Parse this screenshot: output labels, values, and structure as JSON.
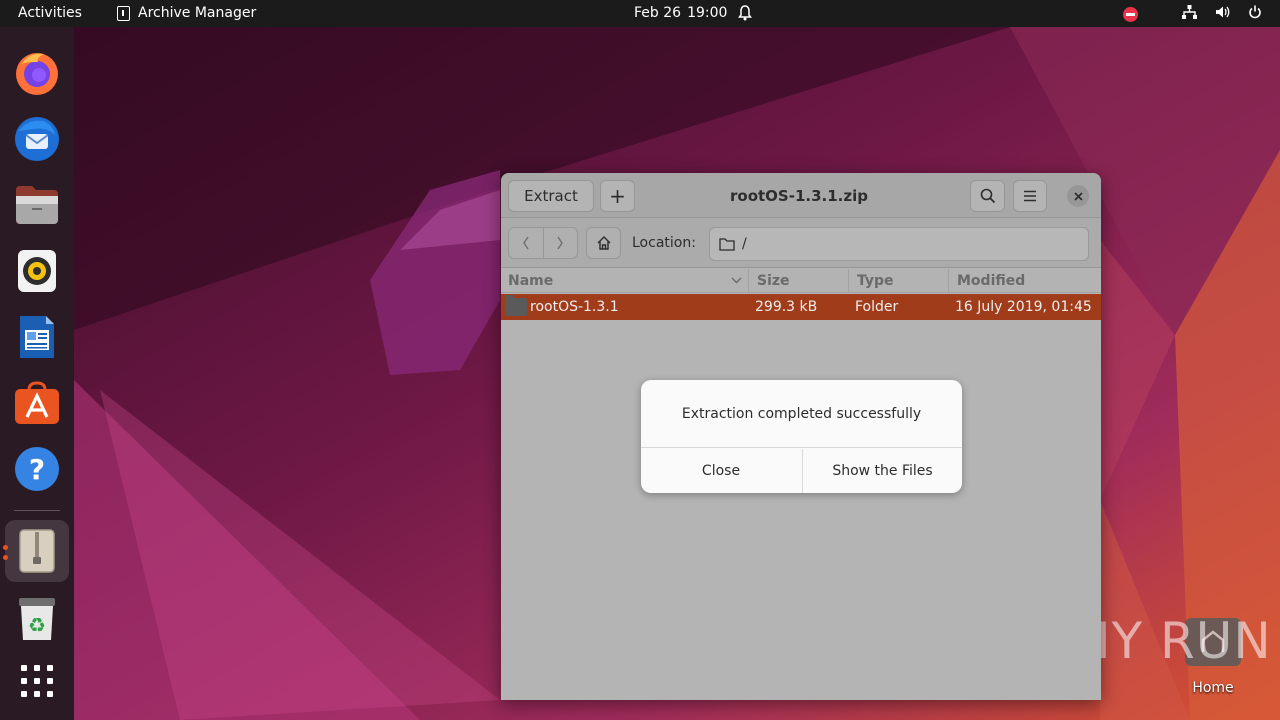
{
  "topbar": {
    "activities": "Activities",
    "app_name": "Archive Manager",
    "date": "Feb 26",
    "time": "19:00"
  },
  "dock": {
    "items": [
      {
        "name": "firefox-icon"
      },
      {
        "name": "thunderbird-icon"
      },
      {
        "name": "files-icon"
      },
      {
        "name": "rhythmbox-icon"
      },
      {
        "name": "libreoffice-writer-icon"
      },
      {
        "name": "app-center-icon"
      },
      {
        "name": "help-icon"
      },
      {
        "name": "archive-manager-icon"
      },
      {
        "name": "trash-icon"
      },
      {
        "name": "show-apps-icon"
      }
    ]
  },
  "window": {
    "extract_label": "Extract",
    "add_label": "+",
    "title": "rootOS-1.3.1.zip",
    "location_label": "Location:",
    "location_value": "/",
    "columns": {
      "name": "Name",
      "size": "Size",
      "type": "Type",
      "modified": "Modified"
    },
    "rows": [
      {
        "name": "rootOS-1.3.1",
        "size": "299.3 kB",
        "type": "Folder",
        "modified": "16 July 2019, 01:45"
      }
    ]
  },
  "dialog": {
    "message": "Extraction completed successfully",
    "close_label": "Close",
    "show_files_label": "Show the Files"
  },
  "desktop": {
    "home_label": "Home",
    "watermark": "ANY RUN"
  },
  "colors": {
    "selection": "#a03c1a",
    "accent": "#e95420"
  }
}
